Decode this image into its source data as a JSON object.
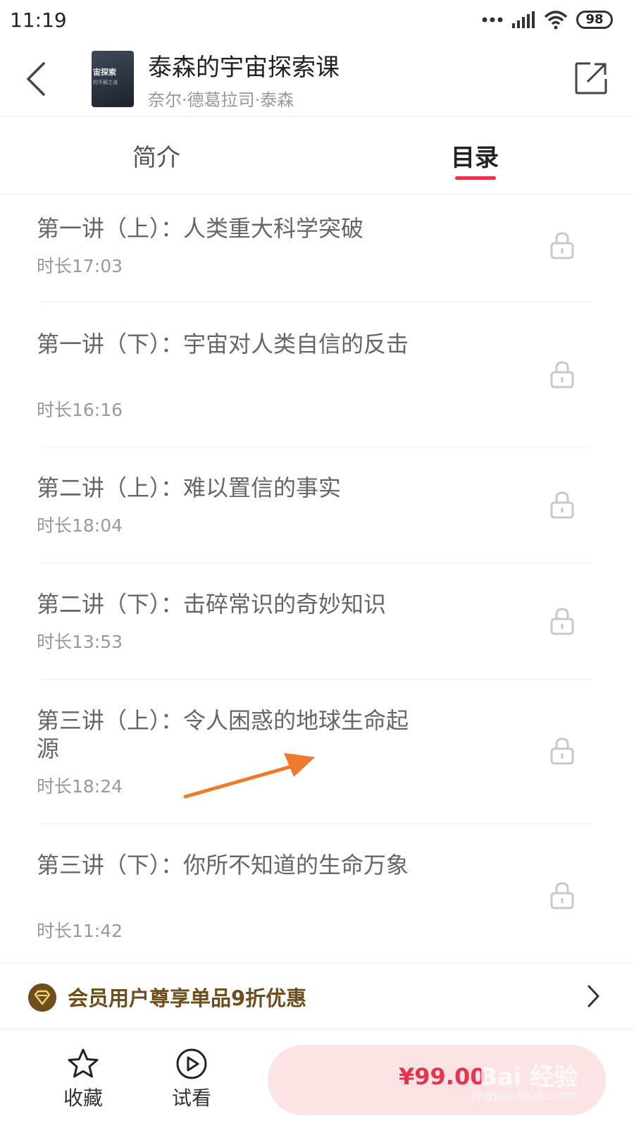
{
  "status_bar": {
    "time": "11:19",
    "battery": "98"
  },
  "header": {
    "title": "泰森的宇宙探索课",
    "author": "奈尔·德葛拉司·泰森",
    "cover_text": "宙探索",
    "cover_sub": "的不解之谜"
  },
  "tabs": [
    {
      "label": "简介",
      "active": false
    },
    {
      "label": "目录",
      "active": true
    }
  ],
  "accent_color": "#e8334a",
  "lessons": [
    {
      "title": "第一讲（上）：人类重大科学突破",
      "duration": "时长17:03",
      "locked": true
    },
    {
      "title": "第一讲（下）：宇宙对人类自信的反击",
      "duration": "时长16:16",
      "locked": true
    },
    {
      "title": "第二讲（上）：难以置信的事实",
      "duration": "时长18:04",
      "locked": true
    },
    {
      "title": "第二讲（下）：击碎常识的奇妙知识",
      "duration": "时长13:53",
      "locked": true
    },
    {
      "title": "第三讲（上）：令人困惑的地球生命起源",
      "duration": "时长18:24",
      "locked": true
    },
    {
      "title": "第三讲（下）：你所不知道的生命万象",
      "duration": "时长11:42",
      "locked": true
    }
  ],
  "promo": {
    "text": "会员用户尊享单品9折优惠"
  },
  "bottom_bar": {
    "favorite_label": "收藏",
    "trial_label": "试看",
    "price": "¥99.00"
  },
  "watermark": {
    "main": "Bai 经验",
    "sub": "jingyan.baidu.com"
  }
}
